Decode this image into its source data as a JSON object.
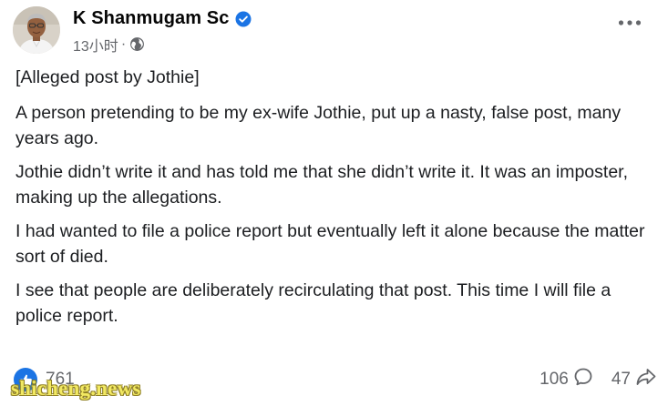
{
  "post": {
    "author": {
      "name": "K Shanmugam Sc",
      "verified_icon": "verified-badge-icon",
      "avatar_icon": "profile-photo"
    },
    "timestamp": "13小时",
    "separator": "·",
    "audience_icon": "globe-icon",
    "more_icon": "more-dots-icon",
    "paragraphs": [
      "[Alleged post by Jothie]",
      "A person pretending to be my ex-wife Jothie, put up a nasty, false post, many years ago.",
      "Jothie didn’t write it and has told me that she didn’t write it. It was an imposter, making up the allegations.",
      "I had wanted to file a police report but eventually left it alone because the matter sort of died.",
      "I see that people are deliberately recirculating that post. This time I will file a police report."
    ],
    "reactions": {
      "count": "761",
      "icon": "like-icon"
    },
    "comments": {
      "count": "106",
      "icon": "comment-icon"
    },
    "shares": {
      "count": "47",
      "icon": "share-icon"
    }
  },
  "watermark": "shicheng.news",
  "colors": {
    "primary_text": "#050505",
    "secondary_text": "#65676b",
    "verified_blue": "#1b74e4",
    "watermark_yellow": "#f2e85a"
  }
}
